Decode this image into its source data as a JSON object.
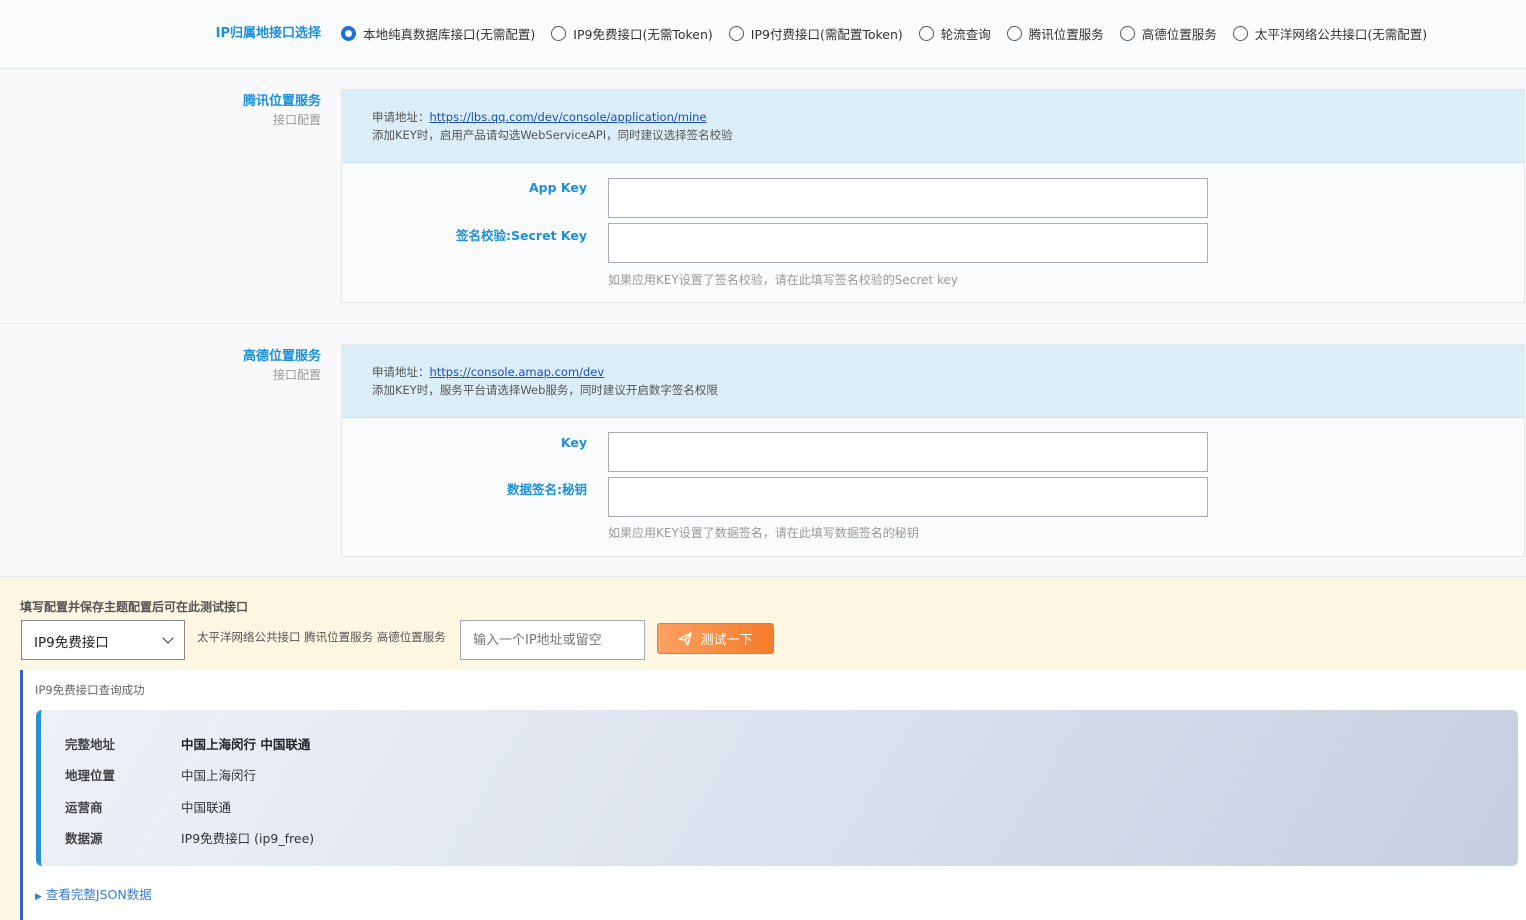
{
  "radio_section": {
    "label": "IP归属地接口选择",
    "options": [
      {
        "label": "本地纯真数据库接口(无需配置)",
        "checked": true
      },
      {
        "label": "IP9免费接口(无需Token)",
        "checked": false
      },
      {
        "label": "IP9付费接口(需配置Token)",
        "checked": false
      },
      {
        "label": "轮流查询",
        "checked": false
      },
      {
        "label": "腾讯位置服务",
        "checked": false
      },
      {
        "label": "高德位置服务",
        "checked": false
      },
      {
        "label": "太平洋网络公共接口(无需配置)",
        "checked": false
      }
    ]
  },
  "tencent": {
    "title": "腾讯位置服务",
    "subtitle": "接口配置",
    "apply_prefix": "申请地址：",
    "apply_url": "https://lbs.qq.com/dev/console/application/mine",
    "note": "添加KEY时，启用产品请勾选WebServiceAPI，同时建议选择签名校验",
    "field1_label": "App Key",
    "field1_value": "",
    "field2_label": "签名校验:Secret Key",
    "field2_value": "",
    "hint": "如果应用KEY设置了签名校验，请在此填写签名校验的Secret key"
  },
  "amap": {
    "title": "高德位置服务",
    "subtitle": "接口配置",
    "apply_prefix": "申请地址：",
    "apply_url": "https://console.amap.com/dev",
    "note": "添加KEY时，服务平台请选择Web服务，同时建议开启数字签名权限",
    "field1_label": "Key",
    "field1_value": "",
    "field2_label": "数据签名:秘钥",
    "field2_value": "",
    "hint": "如果应用KEY设置了数据签名，请在此填写数据签名的秘钥"
  },
  "test": {
    "title": "填写配置并保存主题配置后可在此测试接口",
    "selected_interface": "IP9免费接口",
    "providers_text": "太平洋网络公共接口 腾讯位置服务 高德位置服务",
    "ip_placeholder": "输入一个IP地址或留空",
    "button_label": "测试一下"
  },
  "result": {
    "status": "IP9免费接口查询成功",
    "rows": [
      {
        "key": "完整地址",
        "value": "中国上海闵行 中国联通"
      },
      {
        "key": "地理位置",
        "value": "中国上海闵行"
      },
      {
        "key": "运营商",
        "value": "中国联通"
      },
      {
        "key": "数据源",
        "value": "IP9免费接口 (ip9_free)"
      }
    ],
    "json_toggle": "查看完整JSON数据"
  },
  "colors": {
    "label_blue": "#1e90d6",
    "radio_checked": "#1e6fe0",
    "test_bg": "#fdf6e2",
    "button_orange": "#f57c2a",
    "result_border": "#3b5fc8"
  }
}
